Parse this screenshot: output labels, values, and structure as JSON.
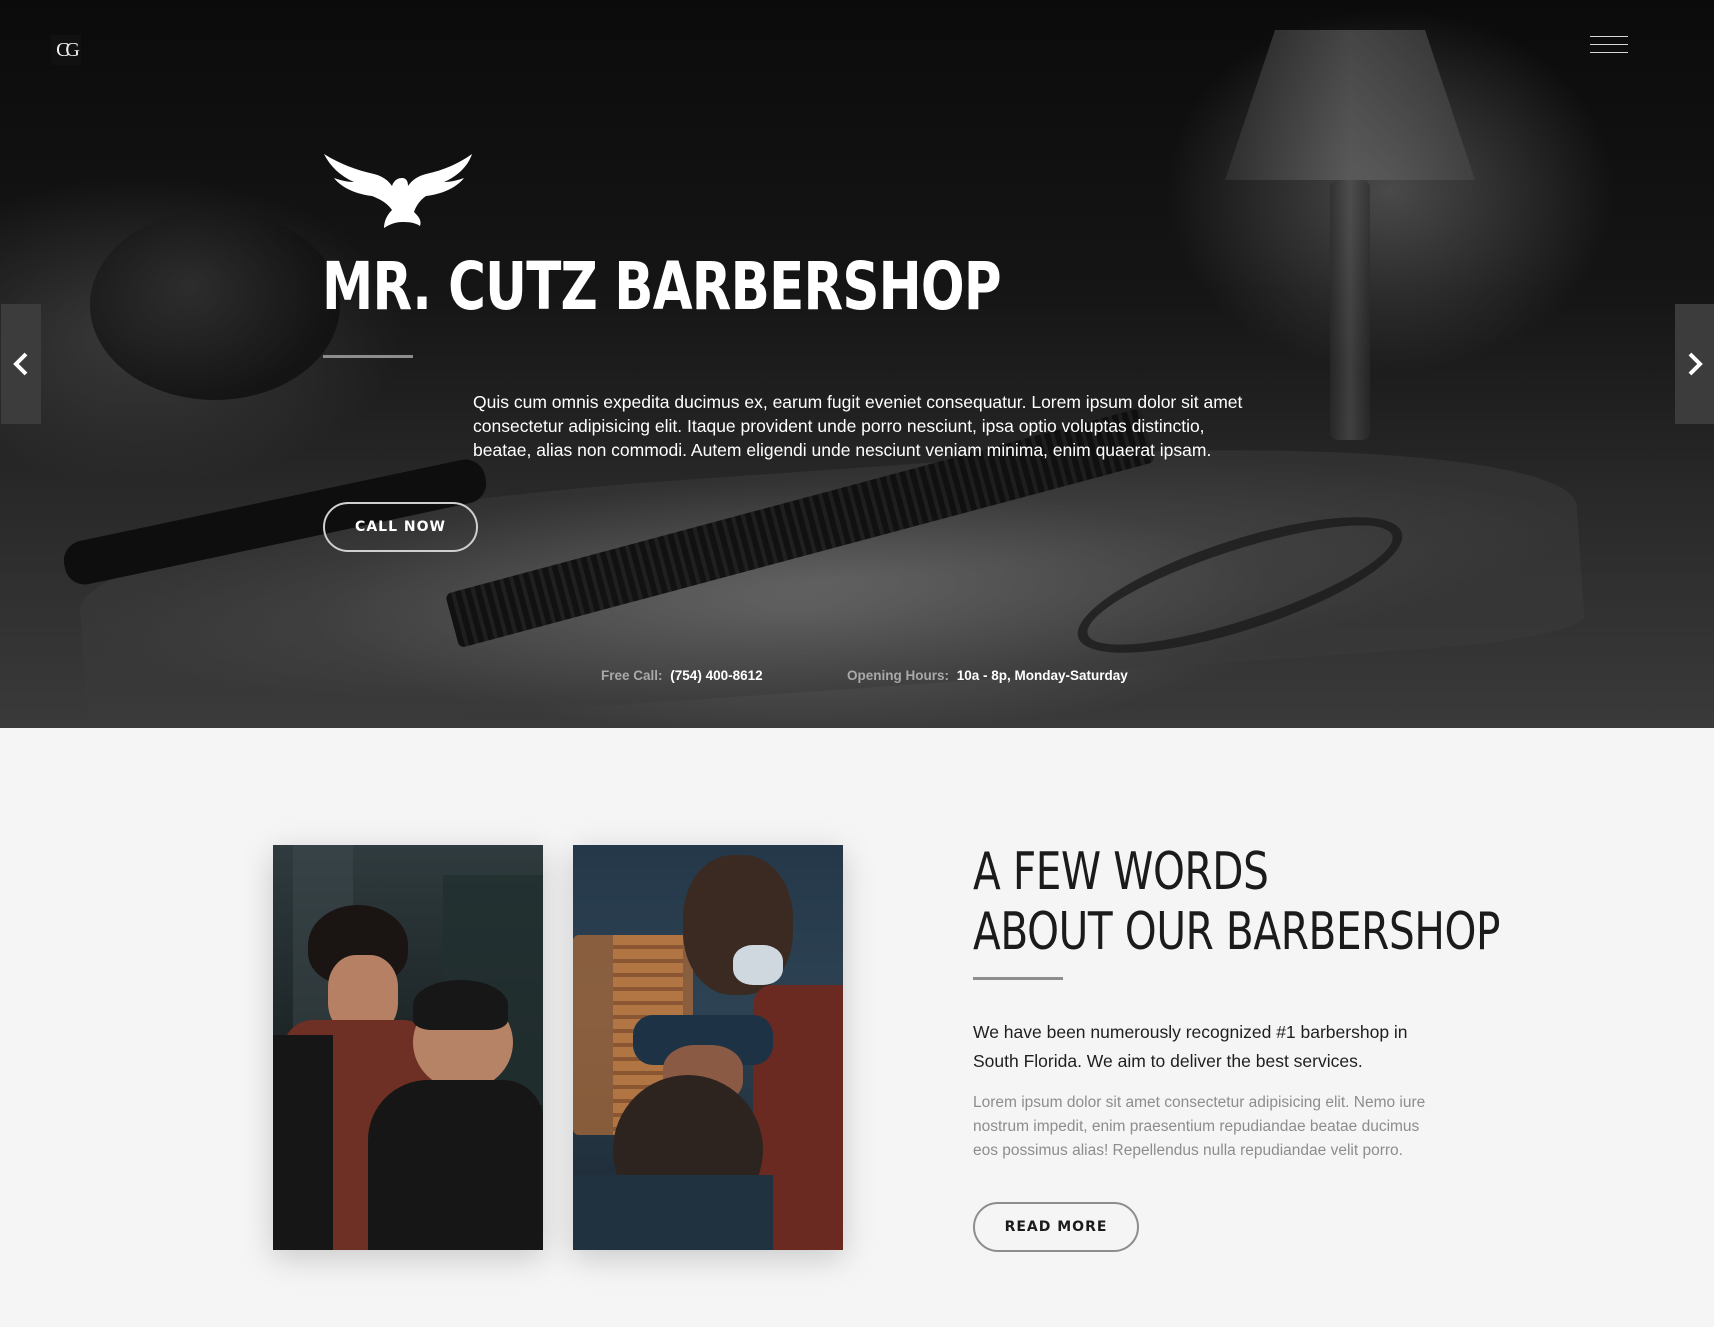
{
  "header": {
    "logo_text": "CG",
    "menu_icon": "hamburger-menu-icon"
  },
  "hero": {
    "emblem_icon": "eagle-icon",
    "title": "MR. CUTZ BARBERSHOP",
    "text": "Quis cum omnis expedita ducimus ex, earum fugit eveniet consequatur. Lorem ipsum dolor sit amet consectetur adipisicing elit. Itaque provident unde porro nesciunt, ipsa optio voluptas distinctio, beatae, alias non commodi. Autem eligendi unde nesciunt veniam minima, enim quaerat ipsam.",
    "cta_label": "CALL NOW",
    "prev_icon": "chevron-left-icon",
    "next_icon": "chevron-right-icon",
    "info": {
      "call_label": "Free Call:",
      "call_value": "(754) 400-8612",
      "hours_label": "Opening Hours:",
      "hours_value": "10a - 8p, Monday-Saturday"
    }
  },
  "about": {
    "title_line1": "A FEW WORDS",
    "title_line2": "ABOUT OUR BARBERSHOP",
    "lead": "We have been numerously recognized #1 barbershop in South Florida. We aim to deliver the best services.",
    "text": "Lorem ipsum dolor sit amet consectetur adipisicing elit. Nemo iure nostrum impedit, enim praesentium repudiandae beatae ducimus eos possimus alias! Repellendus nulla repudiandae velit porro.",
    "button_label": "READ MORE"
  },
  "colors": {
    "hero_text": "#ffffff",
    "accent_divider": "#8d8d8d",
    "page_background": "#f5f5f5"
  }
}
